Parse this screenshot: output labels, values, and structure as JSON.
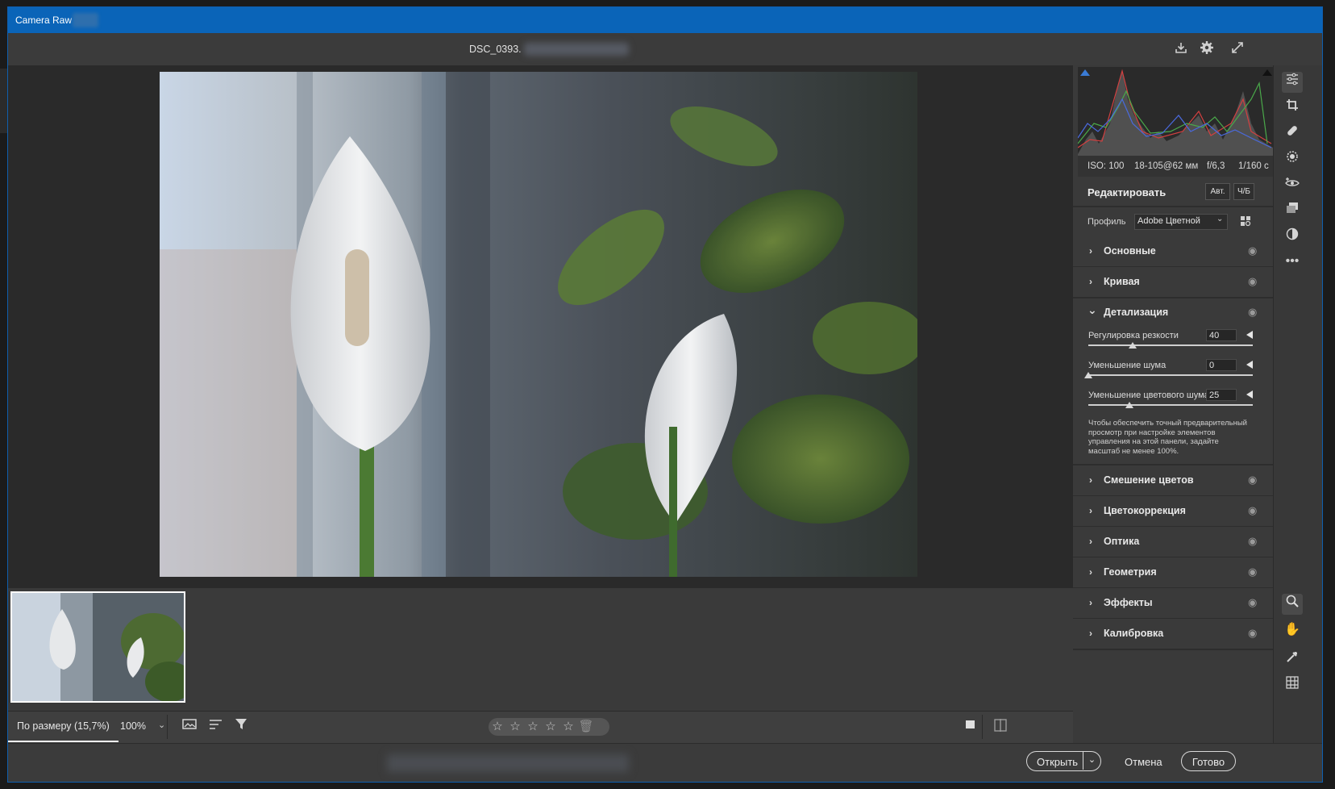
{
  "window": {
    "title": "Camera Raw"
  },
  "header": {
    "filename": "DSC_0393."
  },
  "exif": {
    "iso": "ISO: 100",
    "lens": "18-105@62 мм",
    "aperture": "f/6,3",
    "shutter": "1/160 с"
  },
  "edit": {
    "title": "Редактировать",
    "auto_label": "Авт.",
    "bw_label": "Ч/Б"
  },
  "profile": {
    "label": "Профиль",
    "value": "Adobe Цветной"
  },
  "sections_top": [
    {
      "chevron": "›",
      "name": "Основные"
    },
    {
      "chevron": "›",
      "name": "Кривая"
    }
  ],
  "detail": {
    "name": "Детализация",
    "chevron": "⌄",
    "sliders": [
      {
        "label": "Регулировка резкости",
        "value": "40",
        "level": 0.27
      },
      {
        "label": "Уменьшение шума",
        "value": "0",
        "level": 0.0
      },
      {
        "label": "Уменьшение цветового шума",
        "value": "25",
        "level": 0.25
      }
    ],
    "note": "Чтобы обеспечить точный предварительный просмотр при настройке элементов управления на этой панели, задайте масштаб не менее 100%."
  },
  "sections_bottom": [
    {
      "chevron": "›",
      "name": "Смешение цветов"
    },
    {
      "chevron": "›",
      "name": "Цветокоррекция"
    },
    {
      "chevron": "›",
      "name": "Оптика"
    },
    {
      "chevron": "›",
      "name": "Геометрия"
    },
    {
      "chevron": "›",
      "name": "Эффекты"
    },
    {
      "chevron": "›",
      "name": "Калибровка"
    }
  ],
  "bottombar": {
    "fit_label": "По размеру (15,7%)",
    "zoom_value": "100%"
  },
  "rating": {
    "stars": 0,
    "max": 5
  },
  "footer": {
    "open_label": "Открыть",
    "cancel_label": "Отмена",
    "done_label": "Готово"
  },
  "icons": {
    "save": "download-icon",
    "settings": "gear-icon",
    "fullscreen": "expand-icon",
    "eye": "eye-icon",
    "filter": "filter-icon",
    "sort": "sort-icon",
    "filmstrip": "filmstrip-icon",
    "tools": [
      "sliders-icon",
      "crop-icon",
      "healing-icon",
      "mask-icon",
      "redeye-icon",
      "snapshots-icon",
      "presets-icon",
      "more-icon",
      "zoom-icon",
      "hand-icon",
      "eyedropper-icon",
      "grid-icon"
    ]
  },
  "colors": {
    "titlebar": "#0a64b8",
    "panel": "#3a3a3a",
    "canvas": "#2a2a2a"
  }
}
